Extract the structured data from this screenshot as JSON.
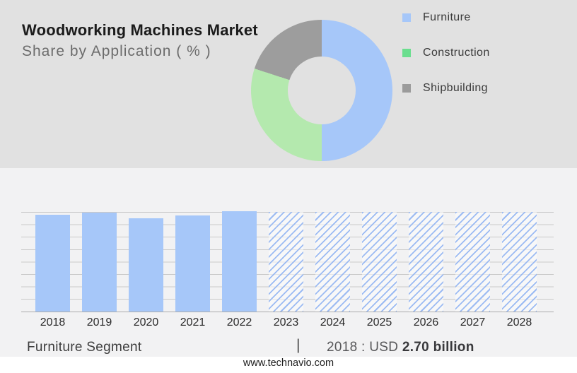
{
  "header": {
    "title": "Woodworking Machines Market",
    "subtitle": "Share by Application ( % )"
  },
  "legend": {
    "position": "right",
    "items": [
      {
        "label": "Furniture",
        "color": "#a6c7f9"
      },
      {
        "label": "Construction",
        "color": "#6ade8e"
      },
      {
        "label": "Shipbuilding",
        "color": "#9b9b9b"
      }
    ]
  },
  "chart_data": [
    {
      "type": "pie",
      "title": "Woodworking Machines Market — Share by Application (%)",
      "donut": true,
      "labels": [
        "Furniture",
        "Construction",
        "Shipbuilding"
      ],
      "values": [
        50,
        30,
        20
      ],
      "colors": [
        "#a6c7f9",
        "#b4e9ae",
        "#9d9d9d"
      ],
      "start_angle": "12 o'clock",
      "direction": "clockwise",
      "legend_position": "right",
      "data_labels_shown": false
    },
    {
      "type": "bar",
      "categories": [
        "2018",
        "2019",
        "2020",
        "2021",
        "2022",
        "2023",
        "2024",
        "2025",
        "2026",
        "2027",
        "2028"
      ],
      "values": [
        96.9,
        99.3,
        93.6,
        96.4,
        100.7,
        100,
        100,
        100,
        100,
        100,
        100
      ],
      "value_unit": "relative bar height, % of plot range (no y-axis labels shown)",
      "bar_styles": [
        "solid",
        "solid",
        "solid",
        "solid",
        "solid",
        "hatched",
        "hatched",
        "hatched",
        "hatched",
        "hatched",
        "hatched"
      ],
      "forecast_years": [
        "2023",
        "2024",
        "2025",
        "2026",
        "2027",
        "2028"
      ],
      "known_point": {
        "year": "2018",
        "value": "USD 2.70 billion"
      },
      "bar_color": "#a6c7f9",
      "gridlines": 9,
      "grid_on": true,
      "xlabel": "",
      "ylabel": ""
    }
  ],
  "caption": {
    "segment": "Furniture Segment",
    "separator": "|",
    "value_prefix": "2018 : USD",
    "value_bold": "2.70 billion"
  },
  "footer": {
    "url": "www.technavio.com"
  },
  "colors": {
    "top_section_bg": "#e1e1e1",
    "mid_section_bg": "#f2f2f3",
    "bottom_strip_bg": "#ffffff",
    "accent_blue": "#a6c7f9",
    "pie_green": "#b4e9ae",
    "legend_green": "#6ade8e",
    "slice_gray": "#9d9d9d",
    "gridline": "#c9c9c9",
    "axis_line": "#ababab"
  }
}
